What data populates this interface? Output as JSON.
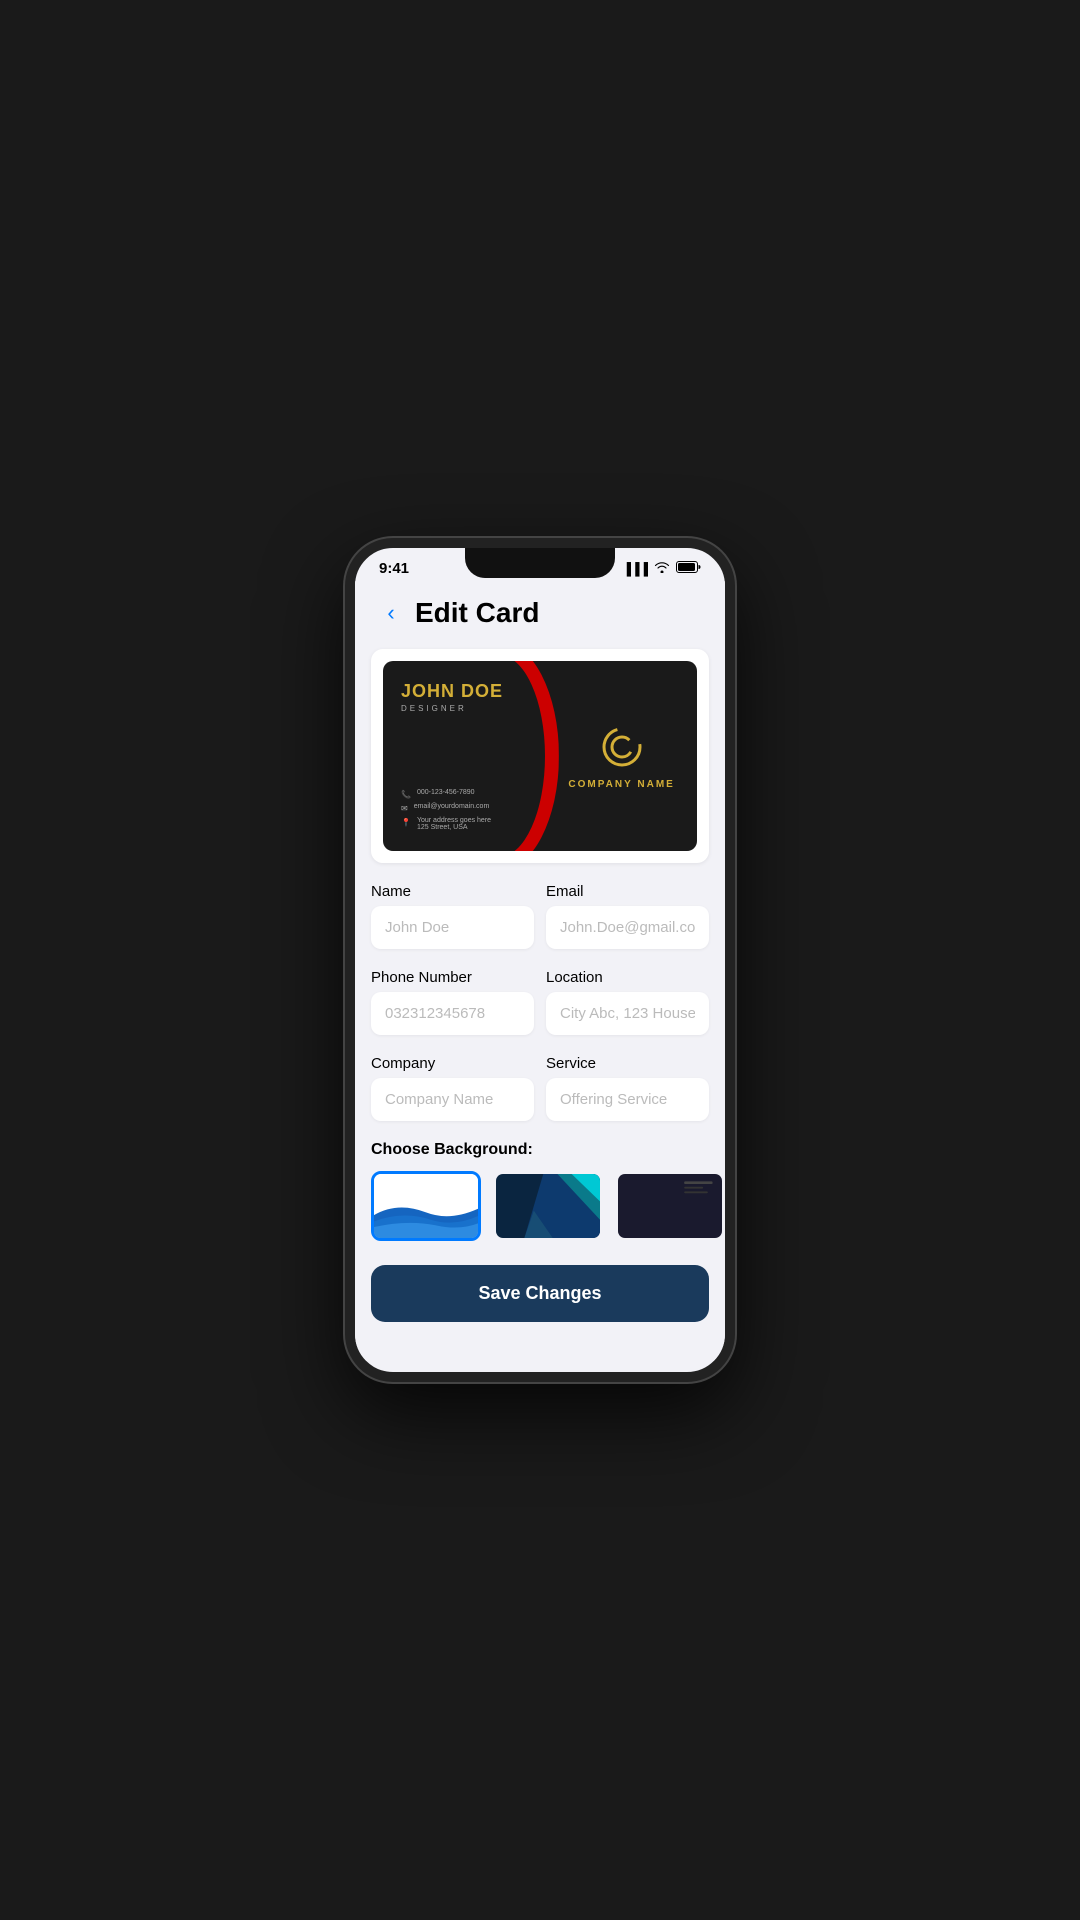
{
  "statusBar": {
    "time": "9:41",
    "signalIcon": "signal-icon",
    "wifiIcon": "wifi-icon",
    "batteryIcon": "battery-icon"
  },
  "header": {
    "backLabel": "‹",
    "title": "Edit Card"
  },
  "businessCard": {
    "name": "JOHN DOE",
    "jobTitle": "DESIGNER",
    "phone": "000-123-456-7890",
    "email": "email@yourdomain.com",
    "address1": "Your address goes here",
    "address2": "125 Street, USA",
    "companyName": "COMPANY NAME"
  },
  "form": {
    "nameLabel": "Name",
    "namePlaceholder": "John Doe",
    "emailLabel": "Email",
    "emailPlaceholder": "John.Doe@gmail.com",
    "phoneLabel": "Phone Number",
    "phonePlaceholder": "032312345678",
    "locationLabel": "Location",
    "locationPlaceholder": "City Abc, 123 House",
    "companyLabel": "Company",
    "companyPlaceholder": "Company Name",
    "serviceLabel": "Service",
    "servicePlaceholder": "Offering Service"
  },
  "backgroundSection": {
    "label": "Choose Background:",
    "options": [
      "bg-white-wave",
      "bg-blue-geo",
      "bg-dark"
    ]
  },
  "saveButton": {
    "label": "Save Changes"
  }
}
